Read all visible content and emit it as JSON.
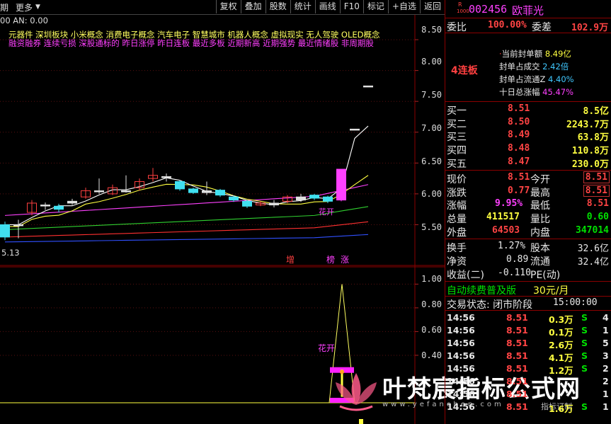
{
  "topbar": {
    "left_label_1": "期",
    "left_label_2": "更多",
    "toolbar": [
      "复权",
      "叠加",
      "股数",
      "统计",
      "画线",
      "F10",
      "标记",
      "+自选",
      "返回"
    ]
  },
  "chart": {
    "ma_header": "00  AN: 0.00",
    "concept_line": "元器件    深圳板块   小米概念 消费电子概念 汽车电子 智慧城市 机器人概念 虚拟现实 无人驾驶 OLED概念",
    "tag_line": "融资融券 连续亏损 深股通标的 昨日涨停 昨日连板 最近多板 近期新高 近期强势 最近情绪股 非周期股",
    "price_axis": [
      "8.50",
      "8.00",
      "7.50",
      "7.00",
      "6.50",
      "6.00",
      "5.50"
    ],
    "low_label": "5.13",
    "badges": [
      "增",
      "榜",
      "涨"
    ],
    "signal_label_main": "花开",
    "sub_axis": [
      "1.00",
      "0.80",
      "0.60",
      "0.40"
    ],
    "signal_label_sub": "花开",
    "chart_data": {
      "type": "line",
      "title": "",
      "candles": [
        {
          "o": 5.3,
          "c": 5.5,
          "h": 5.55,
          "l": 5.25,
          "color": "cyan"
        },
        {
          "o": 5.5,
          "c": 5.5,
          "h": 5.58,
          "l": 5.28,
          "color": "white"
        },
        {
          "o": 5.7,
          "c": 5.85,
          "h": 5.9,
          "l": 5.65,
          "color": "red"
        },
        {
          "o": 5.82,
          "c": 5.82,
          "h": 5.86,
          "l": 5.74,
          "color": "white"
        },
        {
          "o": 5.8,
          "c": 5.75,
          "h": 5.84,
          "l": 5.7,
          "color": "cyan"
        },
        {
          "o": 5.88,
          "c": 5.85,
          "h": 5.92,
          "l": 5.82,
          "color": "white"
        },
        {
          "o": 5.95,
          "c": 6.05,
          "h": 6.1,
          "l": 5.92,
          "color": "red"
        },
        {
          "o": 6.05,
          "c": 6.05,
          "h": 6.25,
          "l": 6.0,
          "color": "white"
        },
        {
          "o": 6.0,
          "c": 6.1,
          "h": 6.15,
          "l": 5.98,
          "color": "red"
        },
        {
          "o": 6.05,
          "c": 6.05,
          "h": 6.3,
          "l": 6.02,
          "color": "white"
        },
        {
          "o": 6.1,
          "c": 6.2,
          "h": 6.25,
          "l": 6.05,
          "color": "red"
        },
        {
          "o": 6.25,
          "c": 6.3,
          "h": 6.42,
          "l": 6.2,
          "color": "red"
        },
        {
          "o": 6.28,
          "c": 6.28,
          "h": 6.33,
          "l": 6.2,
          "color": "white"
        },
        {
          "o": 6.2,
          "c": 6.08,
          "h": 6.22,
          "l": 6.05,
          "color": "cyan"
        },
        {
          "o": 6.08,
          "c": 6.02,
          "h": 6.1,
          "l": 6.0,
          "color": "cyan"
        },
        {
          "o": 6.05,
          "c": 6.02,
          "h": 6.2,
          "l": 5.98,
          "color": "white"
        },
        {
          "o": 6.06,
          "c": 5.98,
          "h": 6.08,
          "l": 5.95,
          "color": "cyan"
        },
        {
          "o": 5.95,
          "c": 5.9,
          "h": 5.97,
          "l": 5.87,
          "color": "cyan"
        },
        {
          "o": 5.88,
          "c": 5.8,
          "h": 5.9,
          "l": 5.77,
          "color": "cyan"
        },
        {
          "o": 5.82,
          "c": 5.85,
          "h": 5.88,
          "l": 5.8,
          "color": "red"
        },
        {
          "o": 5.85,
          "c": 5.82,
          "h": 5.9,
          "l": 5.78,
          "color": "white"
        },
        {
          "o": 5.88,
          "c": 5.95,
          "h": 5.98,
          "l": 5.85,
          "color": "red"
        },
        {
          "o": 5.95,
          "c": 5.9,
          "h": 6.0,
          "l": 5.87,
          "color": "white"
        },
        {
          "o": 5.93,
          "c": 5.98,
          "h": 6.0,
          "l": 5.9,
          "color": "cyan"
        },
        {
          "o": 5.95,
          "c": 5.88,
          "h": 5.97,
          "l": 5.85,
          "color": "cyan"
        },
        {
          "o": 5.9,
          "c": 6.4,
          "h": 6.4,
          "l": 5.88,
          "color": "magenta"
        },
        {
          "o": 7.05,
          "c": 7.05,
          "h": 7.05,
          "l": 7.05,
          "color": "white"
        },
        {
          "o": 7.75,
          "c": 7.75,
          "h": 7.75,
          "l": 7.75,
          "color": "white"
        }
      ],
      "ylim": [
        5.0,
        8.65
      ],
      "sub_ylim": [
        0,
        1.05
      ],
      "signal_value": 1.0
    }
  },
  "panel": {
    "code": "002456",
    "name": "欧菲光",
    "r_badge": "R",
    "l_badge": "1000",
    "wei_bi_label": "委比",
    "wei_bi_value": "100.00%",
    "wei_cha_label": "委差",
    "wei_cha_value": "102.9万",
    "lianban": "4连板",
    "seal_info": [
      {
        "label": "当前封单额",
        "value": "8.49亿",
        "color": "yellow"
      },
      {
        "label": "封单占成交",
        "value": "2.42倍",
        "color": "cyan"
      },
      {
        "label": "封单占流通Z",
        "value": "4.40%",
        "color": "cyan"
      },
      {
        "label": "十日总涨幅",
        "value": "45.47%",
        "color": "magenta"
      }
    ],
    "bids": [
      {
        "label": "买一",
        "price": "8.51",
        "vol": "8.5亿"
      },
      {
        "label": "买二",
        "price": "8.50",
        "vol": "2243.7万"
      },
      {
        "label": "买三",
        "price": "8.49",
        "vol": "63.8万"
      },
      {
        "label": "买四",
        "price": "8.48",
        "vol": "110.8万"
      },
      {
        "label": "买五",
        "price": "8.47",
        "vol": "230.0万"
      }
    ],
    "quote": {
      "now_label": "现价",
      "now": "8.51",
      "open_label": "今开",
      "open": "8.51",
      "chg_label": "涨跌",
      "chg": "0.77",
      "high_label": "最高",
      "high": "8.51",
      "pct_label": "涨幅",
      "pct": "9.95%",
      "low_label": "最低",
      "low": "8.51",
      "vol_label": "总量",
      "vol": "411517",
      "vr_label": "量比",
      "vr": "0.60",
      "outer_label": "外盘",
      "outer": "64503",
      "inner_label": "内盘",
      "inner": "347014",
      "turn_label": "换手",
      "turn": "1.27%",
      "shares_label": "股本",
      "shares": "32.6亿",
      "nav_label": "净资",
      "nav": "0.89",
      "float_label": "流通",
      "float": "32.4亿",
      "eps_label": "收益(二)",
      "eps": "-0.110",
      "pe_label": "PE(动)",
      "pe": ""
    },
    "ad_left": "自动续费普及版",
    "ad_right": "30元/月",
    "status_label": "交易状态: 闭市阶段",
    "status_time": "15:00:00",
    "ticks": [
      {
        "t": "14:56",
        "p": "8.51",
        "v": "0.3万",
        "s": "S",
        "n": "4"
      },
      {
        "t": "14:56",
        "p": "8.51",
        "v": "0.1万",
        "s": "S",
        "n": "1"
      },
      {
        "t": "14:56",
        "p": "8.51",
        "v": "2.6万",
        "s": "S",
        "n": "5"
      },
      {
        "t": "14:56",
        "p": "8.51",
        "v": "4.1万",
        "s": "S",
        "n": "3"
      },
      {
        "t": "14:56",
        "p": "8.51",
        "v": "1.2万",
        "s": "S",
        "n": "2"
      },
      {
        "t": "14:56",
        "p": "8.51",
        "v": "",
        "s": "",
        "n": "2"
      },
      {
        "t": "14:56",
        "p": "8.51",
        "v": "",
        "s": "",
        "n": "1"
      },
      {
        "t": "14:56",
        "p": "8.51",
        "v": "1.6万",
        "s": "S",
        "n": "1"
      }
    ]
  },
  "watermark": {
    "text": "叶梵宸指标公式网",
    "url": "www.yefanchen.com",
    "slogan": "指标订制"
  }
}
